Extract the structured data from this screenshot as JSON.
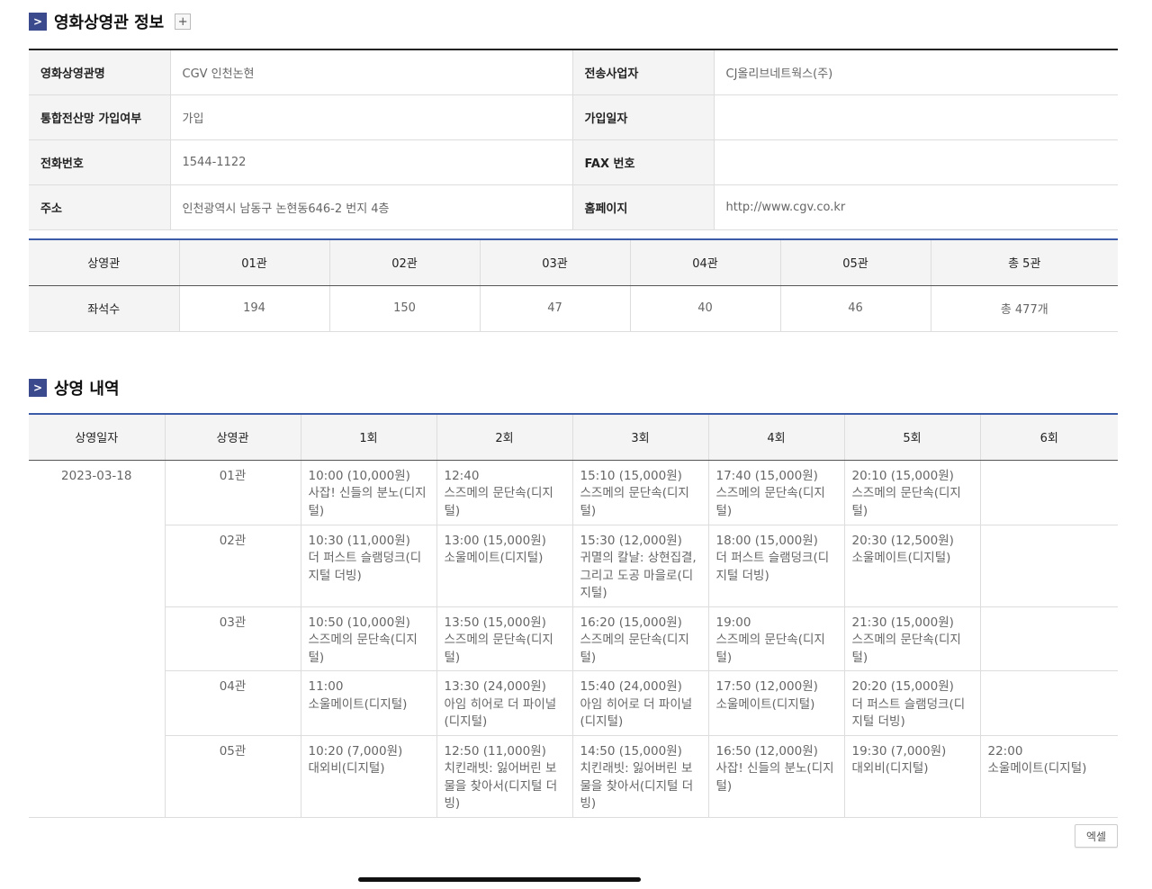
{
  "section1": {
    "title": "영화상영관 정보",
    "plus": "+",
    "arrow": ">"
  },
  "info": [
    [
      {
        "label": "영화상영관명",
        "value": "CGV 인천논현"
      },
      {
        "label": "전송사업자",
        "value": "CJ올리브네트웍스(주)"
      }
    ],
    [
      {
        "label": "통합전산망 가입여부",
        "value": "가입"
      },
      {
        "label": "가입일자",
        "value": ""
      }
    ],
    [
      {
        "label": "전화번호",
        "value": "1544-1122"
      },
      {
        "label": "FAX 번호",
        "value": ""
      }
    ],
    [
      {
        "label": "주소",
        "value": "인천광역시 남동구 논현동646-2 번지 4층"
      },
      {
        "label": "홈페이지",
        "value": "http://www.cgv.co.kr"
      }
    ]
  ],
  "seats": {
    "header_label": "상영관",
    "halls": [
      "01관",
      "02관",
      "03관",
      "04관",
      "05관",
      "총 5관"
    ],
    "row_label": "좌석수",
    "counts": [
      "194",
      "150",
      "47",
      "40",
      "46",
      "총 477개"
    ]
  },
  "section2": {
    "title": "상영 내역",
    "arrow": ">"
  },
  "schedule": {
    "headers": [
      "상영일자",
      "상영관",
      "1회",
      "2회",
      "3회",
      "4회",
      "5회",
      "6회"
    ],
    "date": "2023-03-18",
    "rows": [
      {
        "hall": "01관",
        "shows": [
          {
            "time": "10:00 (10,000원)",
            "title": "사잡! 신들의 분노(디지털)",
            "red": false
          },
          {
            "time": "12:40",
            "title": "스즈메의 문단속(디지털)",
            "red": true
          },
          {
            "time": "15:10 (15,000원)",
            "title": "스즈메의 문단속(디지털)",
            "red": false
          },
          {
            "time": "17:40 (15,000원)",
            "title": "스즈메의 문단속(디지털)",
            "red": false
          },
          {
            "time": "20:10 (15,000원)",
            "title": "스즈메의 문단속(디지털)",
            "red": false
          },
          {
            "time": "",
            "title": "",
            "red": false
          }
        ]
      },
      {
        "hall": "02관",
        "shows": [
          {
            "time": "10:30 (11,000원)",
            "title": "더 퍼스트 슬램덩크(디지털 더빙)",
            "red": false
          },
          {
            "time": "13:00 (15,000원)",
            "title": "소울메이트(디지털)",
            "red": false
          },
          {
            "time": "15:30 (12,000원)",
            "title": "귀멸의 칼날: 상현집결, 그리고 도공 마을로(디지털)",
            "red": false
          },
          {
            "time": "18:00 (15,000원)",
            "title": "더 퍼스트 슬램덩크(디지털 더빙)",
            "red": false
          },
          {
            "time": "20:30 (12,500원)",
            "title": "소울메이트(디지털)",
            "red": false
          },
          {
            "time": "",
            "title": "",
            "red": false
          }
        ]
      },
      {
        "hall": "03관",
        "shows": [
          {
            "time": "10:50 (10,000원)",
            "title": "스즈메의 문단속(디지털)",
            "red": false
          },
          {
            "time": "13:50 (15,000원)",
            "title": "스즈메의 문단속(디지털)",
            "red": false
          },
          {
            "time": "16:20 (15,000원)",
            "title": "스즈메의 문단속(디지털)",
            "red": false
          },
          {
            "time": "19:00",
            "title": "스즈메의 문단속(디지털)",
            "red": true
          },
          {
            "time": "21:30 (15,000원)",
            "title": "스즈메의 문단속(디지털)",
            "red": false
          },
          {
            "time": "",
            "title": "",
            "red": false
          }
        ]
      },
      {
        "hall": "04관",
        "shows": [
          {
            "time": "11:00",
            "title": "소울메이트(디지털)",
            "red": true
          },
          {
            "time": "13:30 (24,000원)",
            "title": "아임 히어로 더 파이널(디지털)",
            "red": false
          },
          {
            "time": "15:40 (24,000원)",
            "title": "아임 히어로 더 파이널(디지털)",
            "red": false
          },
          {
            "time": "17:50 (12,000원)",
            "title": "소울메이트(디지털)",
            "red": false
          },
          {
            "time": "20:20 (15,000원)",
            "title": "더 퍼스트 슬램덩크(디지털 더빙)",
            "red": false
          },
          {
            "time": "",
            "title": "",
            "red": false
          }
        ]
      },
      {
        "hall": "05관",
        "shows": [
          {
            "time": "10:20 (7,000원)",
            "title": "대외비(디지털)",
            "red": false
          },
          {
            "time": "12:50 (11,000원)",
            "title": "치킨래빗: 잃어버린 보물을 찾아서(디지털 더빙)",
            "red": false
          },
          {
            "time": "14:50 (15,000원)",
            "title": "치킨래빗: 잃어버린 보물을 찾아서(디지털 더빙)",
            "red": false
          },
          {
            "time": "16:50 (12,000원)",
            "title": "사잡! 신들의 분노(디지털)",
            "red": false
          },
          {
            "time": "19:30 (7,000원)",
            "title": "대외비(디지털)",
            "red": false
          },
          {
            "time": "22:00",
            "title": "소울메이트(디지털)",
            "red": true
          }
        ]
      }
    ]
  },
  "excel_button": "엑셀",
  "colors": {
    "accent_blue": "#3b5aa8",
    "icon_navy": "#3b4a8c",
    "red": "#d32b2b",
    "header_bg": "#f4f4f4"
  }
}
